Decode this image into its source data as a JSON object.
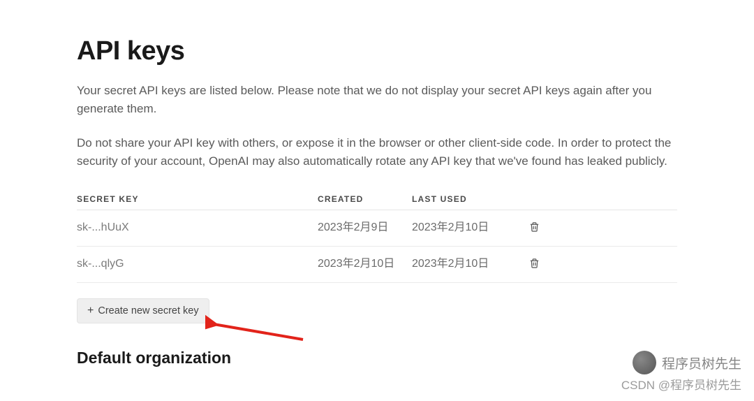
{
  "page": {
    "title": "API keys",
    "description1": "Your secret API keys are listed below. Please note that we do not display your secret API keys again after you generate them.",
    "description2": "Do not share your API key with others, or expose it in the browser or other client-side code. In order to protect the security of your account, OpenAI may also automatically rotate any API key that we've found has leaked publicly."
  },
  "table": {
    "headers": {
      "secret_key": "SECRET KEY",
      "created": "CREATED",
      "last_used": "LAST USED"
    },
    "rows": [
      {
        "key": "sk-...hUuX",
        "created": "2023年2月9日",
        "last_used": "2023年2月10日"
      },
      {
        "key": "sk-...qlyG",
        "created": "2023年2月10日",
        "last_used": "2023年2月10日"
      }
    ]
  },
  "actions": {
    "create_label": "Create new secret key"
  },
  "sections": {
    "default_org": "Default organization"
  },
  "watermark": {
    "line1": "程序员树先生",
    "line2": "CSDN @程序员树先生"
  }
}
